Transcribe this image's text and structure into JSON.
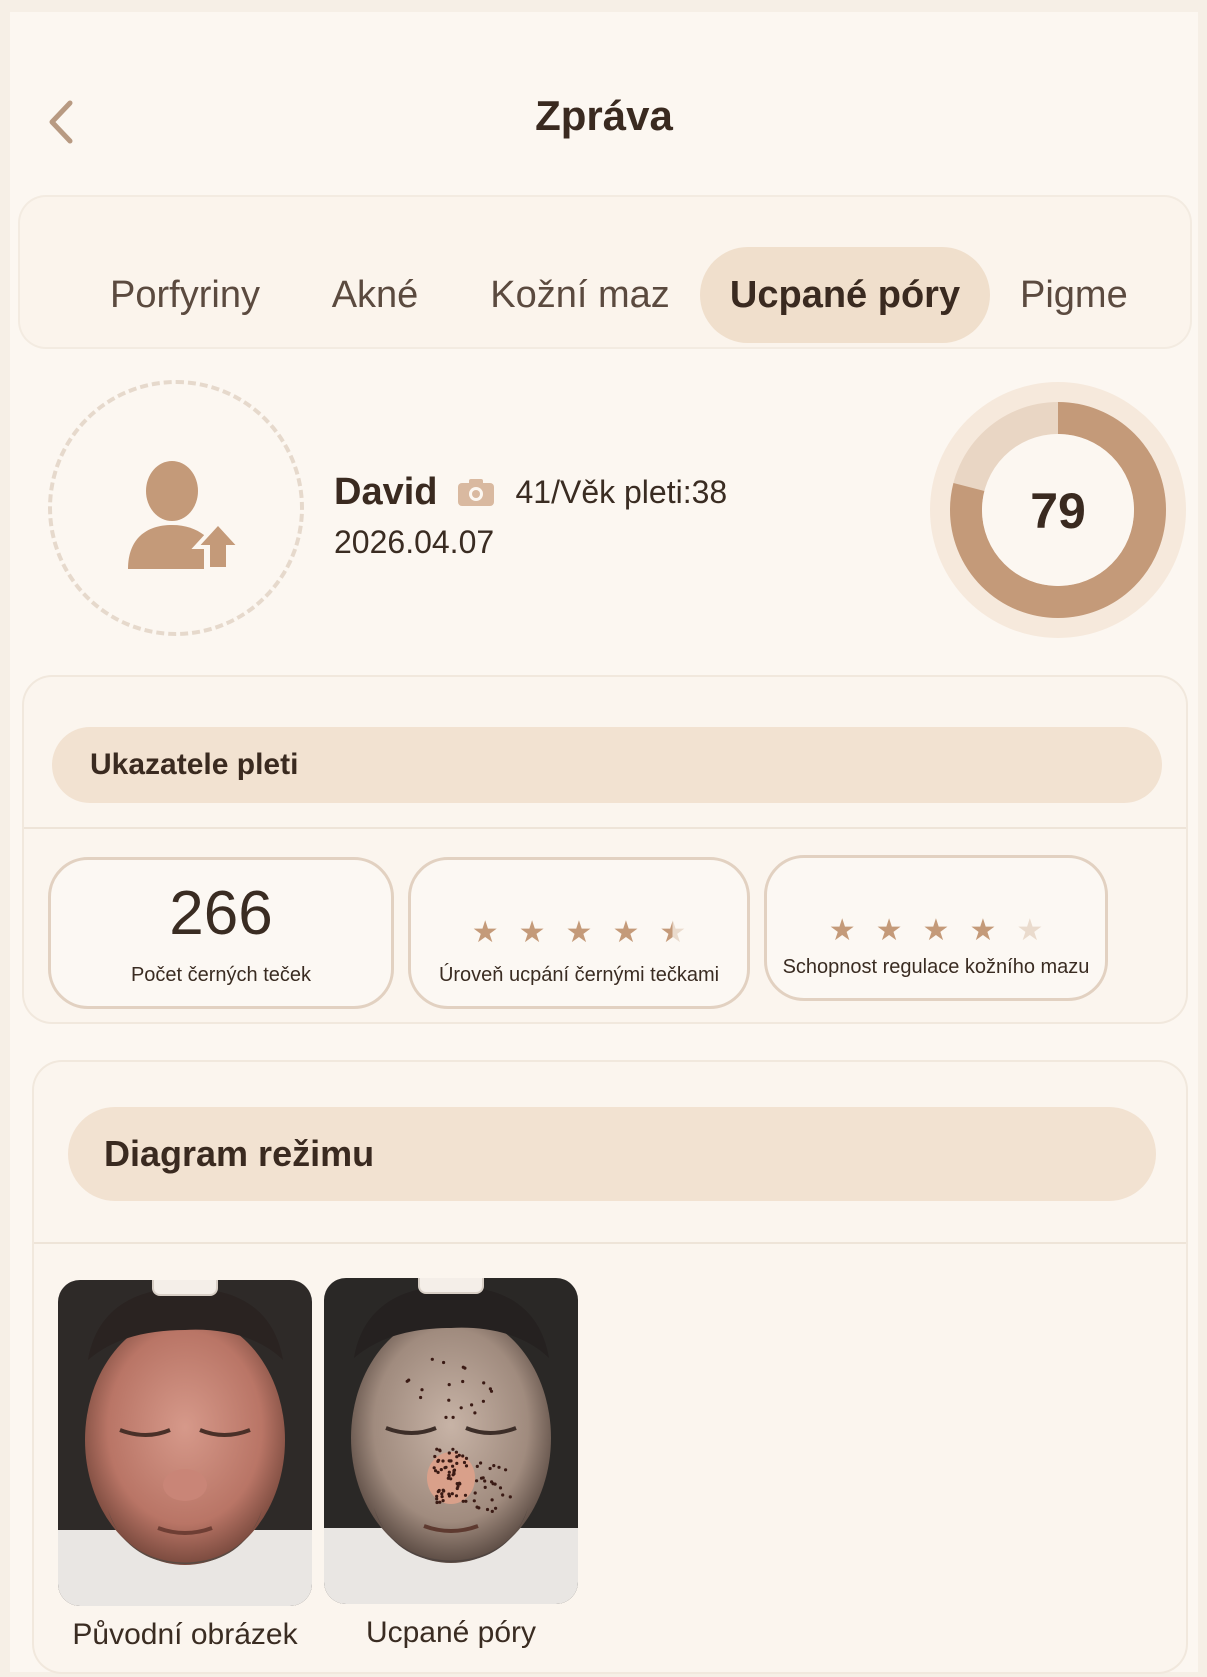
{
  "header": {
    "title": "Zpráva",
    "back_icon": "chevron-left-icon"
  },
  "tabs": [
    {
      "label": "Porfyriny",
      "active": false
    },
    {
      "label": "Akné",
      "active": false
    },
    {
      "label": "Kožní maz",
      "active": false
    },
    {
      "label": "Ucpané póry",
      "active": true
    },
    {
      "label": "Pigme",
      "active": false
    }
  ],
  "profile": {
    "avatar_icon": "user-upload-icon",
    "name": "David",
    "camera_icon": "camera-icon",
    "age_text": "41/Věk pleti:38",
    "date": "2026.04.07",
    "score": "79",
    "score_fraction": 0.79
  },
  "indicators": {
    "title": "Ukazatele pleti",
    "items": [
      {
        "value": "266",
        "label": "Počet černých teček"
      },
      {
        "label": "Úroveň ucpání černými tečkami",
        "stars": 4.5,
        "max_stars": 5
      },
      {
        "label": "Schopnost regulace kožního mazu",
        "stars": 4,
        "max_stars": 5
      }
    ]
  },
  "diagram": {
    "title": "Diagram režimu",
    "images": [
      {
        "caption": "Původní obrázek"
      },
      {
        "caption": "Ucpané póry"
      }
    ]
  },
  "colors": {
    "accent": "#c49a79",
    "tab_active_bg": "#f0dfcc",
    "background": "#fcf7f1",
    "star_dim": "#eadbcd"
  }
}
